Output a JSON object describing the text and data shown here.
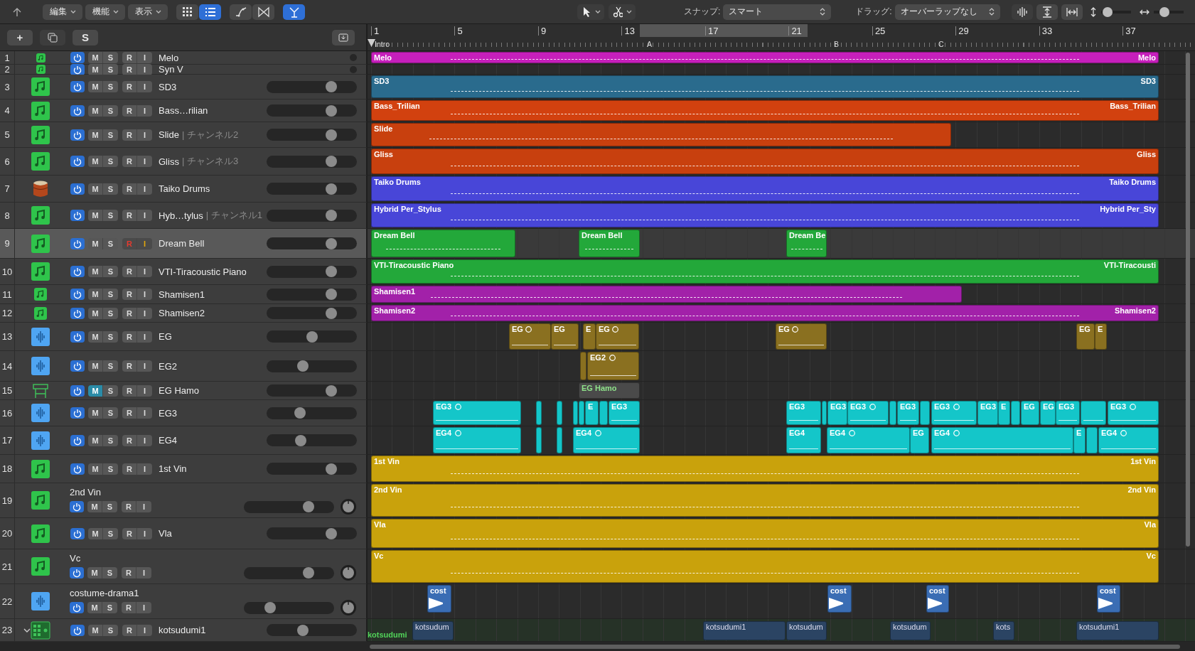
{
  "toolbar": {
    "menus": [
      {
        "label": "編集"
      },
      {
        "label": "機能"
      },
      {
        "label": "表示"
      }
    ],
    "view_tools": [
      {
        "kind": "grid",
        "selected": false
      },
      {
        "kind": "list",
        "selected": true
      },
      {
        "kind": "curve",
        "selected": false
      },
      {
        "kind": "bowtie",
        "selected": false
      },
      {
        "kind": "flex",
        "selected": true
      }
    ],
    "edit_tools": [
      {
        "kind": "pointer"
      },
      {
        "kind": "scissors"
      }
    ],
    "snap": {
      "label": "スナップ:",
      "value": "スマート"
    },
    "drag": {
      "label": "ドラッグ:",
      "value": "オーバーラップなし"
    },
    "zoom_tools": [
      {
        "kind": "waveform"
      },
      {
        "kind": "fit-vertical"
      },
      {
        "kind": "fit-horizontal"
      }
    ],
    "zoom_sliders": [
      {
        "kind": "vertical",
        "level": 0.08
      },
      {
        "kind": "horizontal",
        "level": 0.3
      }
    ]
  },
  "header_tools": [
    {
      "kind": "text",
      "label": "+"
    },
    {
      "kind": "duplicate"
    },
    {
      "kind": "text",
      "label": "S"
    },
    {
      "kind": "catch"
    }
  ],
  "ruler": {
    "bars": [
      "1",
      "5",
      "9",
      "13",
      "17",
      "21",
      "25",
      "29",
      "33",
      "37"
    ],
    "cycle_on": true,
    "markers": [
      {
        "label": "Intro"
      },
      {
        "label": "A"
      },
      {
        "label": "B"
      },
      {
        "label": "C"
      }
    ]
  },
  "tracks": [
    {
      "number": "1",
      "name": "Melo",
      "kind": "instrument",
      "on": true,
      "mute": {
        "label": "M",
        "on": false
      },
      "solo": {
        "label": "S",
        "on": false
      },
      "record": {
        "label": "R",
        "on": false
      },
      "input": {
        "label": "I",
        "on": false
      },
      "selected": false,
      "color": "#c61fbb",
      "regions": [
        {
          "label": "Melo",
          "end_label": "Melo"
        }
      ]
    },
    {
      "number": "2",
      "name": "Syn V",
      "kind": "instrument",
      "on": true,
      "mute": {
        "label": "M",
        "on": false
      },
      "solo": {
        "label": "S",
        "on": false
      },
      "record": {
        "label": "R",
        "on": false
      },
      "input": {
        "label": "I",
        "on": false
      },
      "selected": false
    },
    {
      "number": "3",
      "name": "SD3",
      "kind": "instrument",
      "volume": {
        "level": 0.75
      },
      "on": true,
      "mute": {
        "label": "M",
        "on": false
      },
      "solo": {
        "label": "S",
        "on": false
      },
      "record": {
        "label": "R",
        "on": false
      },
      "input": {
        "label": "I",
        "on": false
      },
      "selected": false,
      "color": "#2a6b8d",
      "regions": [
        {
          "label": "SD3",
          "end_label": "SD3"
        }
      ]
    },
    {
      "number": "4",
      "name": "Bass…rilian",
      "kind": "instrument",
      "volume": {
        "level": 0.75
      },
      "on": true,
      "mute": {
        "label": "M",
        "on": false
      },
      "solo": {
        "label": "S",
        "on": false
      },
      "record": {
        "label": "R",
        "on": false
      },
      "input": {
        "label": "I",
        "on": false
      },
      "selected": false,
      "color": "#d2410f",
      "regions": [
        {
          "label": "Bass_Trilian",
          "end_label": "Bass_Trilian"
        }
      ]
    },
    {
      "number": "5",
      "name": "Slide",
      "channel": "| チャンネル2",
      "kind": "instrument",
      "volume": {
        "level": 0.75
      },
      "on": true,
      "mute": {
        "label": "M",
        "on": false
      },
      "solo": {
        "label": "S",
        "on": false
      },
      "record": {
        "label": "R",
        "on": false
      },
      "input": {
        "label": "I",
        "on": false
      },
      "selected": false,
      "color": "#c8400e",
      "regions": [
        {
          "label": "Slide"
        }
      ]
    },
    {
      "number": "6",
      "name": "Gliss",
      "channel": "| チャンネル3",
      "kind": "instrument",
      "volume": {
        "level": 0.75
      },
      "on": true,
      "mute": {
        "label": "M",
        "on": false
      },
      "solo": {
        "label": "S",
        "on": false
      },
      "record": {
        "label": "R",
        "on": false
      },
      "input": {
        "label": "I",
        "on": false
      },
      "selected": false,
      "color": "#c8400e",
      "regions": [
        {
          "label": "Gliss",
          "end_label": "Gliss"
        }
      ]
    },
    {
      "number": "7",
      "name": "Taiko Drums",
      "kind": "drum",
      "volume": {
        "level": 0.75
      },
      "on": true,
      "mute": {
        "label": "M",
        "on": false
      },
      "solo": {
        "label": "S",
        "on": false
      },
      "record": {
        "label": "R",
        "on": false
      },
      "input": {
        "label": "I",
        "on": false
      },
      "selected": false,
      "color": "#4846d8",
      "regions": [
        {
          "label": "Taiko Drums",
          "end_label": "Taiko Drums"
        }
      ]
    },
    {
      "number": "8",
      "name": "Hyb…tylus",
      "channel": "| チャンネル1",
      "kind": "instrument",
      "volume": {
        "level": 0.75
      },
      "on": true,
      "mute": {
        "label": "M",
        "on": false
      },
      "solo": {
        "label": "S",
        "on": false
      },
      "record": {
        "label": "R",
        "on": false
      },
      "input": {
        "label": "I",
        "on": false
      },
      "selected": false,
      "color": "#4846d8",
      "regions": [
        {
          "label": "Hybrid Per_Stylus",
          "end_label": "Hybrid Per_Sty"
        }
      ]
    },
    {
      "number": "9",
      "name": "Dream Bell",
      "kind": "instrument",
      "volume": {
        "level": 0.75
      },
      "on": true,
      "mute": {
        "label": "M",
        "on": false
      },
      "solo": {
        "label": "S",
        "on": false
      },
      "record": {
        "label": "R",
        "on": true
      },
      "input": {
        "label": "I",
        "on": true
      },
      "selected": true,
      "color": "#23a83a",
      "regions": [
        {
          "label": "Dream Bell"
        },
        {
          "label": "Dream Bell"
        },
        {
          "label": "Dream Be"
        }
      ]
    },
    {
      "number": "10",
      "name": "VTI-Tiracoustic Piano",
      "kind": "instrument",
      "volume": {
        "level": 0.75
      },
      "on": true,
      "mute": {
        "label": "M",
        "on": false
      },
      "solo": {
        "label": "S",
        "on": false
      },
      "record": {
        "label": "R",
        "on": false
      },
      "input": {
        "label": "I",
        "on": false
      },
      "selected": false,
      "color": "#23a83a",
      "regions": [
        {
          "label": "VTI-Tiracoustic Piano",
          "end_label": "VTI-Tiracousti"
        }
      ]
    },
    {
      "number": "11",
      "name": "Shamisen1",
      "kind": "instrument",
      "volume": {
        "level": 0.75
      },
      "on": true,
      "mute": {
        "label": "M",
        "on": false
      },
      "solo": {
        "label": "S",
        "on": false
      },
      "record": {
        "label": "R",
        "on": false
      },
      "input": {
        "label": "I",
        "on": false
      },
      "selected": false,
      "color": "#a221a9",
      "regions": [
        {
          "label": "Shamisen1"
        }
      ]
    },
    {
      "number": "12",
      "name": "Shamisen2",
      "kind": "instrument",
      "volume": {
        "level": 0.75
      },
      "on": true,
      "mute": {
        "label": "M",
        "on": false
      },
      "solo": {
        "label": "S",
        "on": false
      },
      "record": {
        "label": "R",
        "on": false
      },
      "input": {
        "label": "I",
        "on": false
      },
      "selected": false,
      "color": "#a221a9",
      "regions": [
        {
          "label": "Shamisen2",
          "end_label": "Shamisen2"
        }
      ]
    },
    {
      "number": "13",
      "name": "EG",
      "kind": "audio",
      "volume": {
        "level": 0.5
      },
      "on": true,
      "mute": {
        "label": "M",
        "on": false
      },
      "solo": {
        "label": "S",
        "on": false
      },
      "record": {
        "label": "R",
        "on": false
      },
      "input": {
        "label": "I",
        "on": false
      },
      "selected": false,
      "color": "#8a7020",
      "regions": [
        {
          "label": "EG",
          "take_marker": true
        },
        {
          "label": "EG",
          "take_marker": false
        },
        {
          "label": "E",
          "take_marker": false
        },
        {
          "label": "EG",
          "take_marker": true
        },
        {
          "label": "EG",
          "take_marker": true
        },
        {
          "label": "EG",
          "take_marker": false
        },
        {
          "label": "E",
          "take_marker": false
        }
      ]
    },
    {
      "number": "14",
      "name": "EG2",
      "kind": "audio",
      "volume": {
        "level": 0.39
      },
      "on": true,
      "mute": {
        "label": "M",
        "on": false
      },
      "solo": {
        "label": "S",
        "on": false
      },
      "record": {
        "label": "R",
        "on": false
      },
      "input": {
        "label": "I",
        "on": false
      },
      "selected": false,
      "color": "#8a7020",
      "regions": [
        {
          "take_marker": false
        },
        {
          "label": "EG2",
          "take_marker": true
        }
      ]
    },
    {
      "number": "15",
      "name": "EG Hamo",
      "kind": "keyboard",
      "volume": {
        "level": 0.75
      },
      "on": true,
      "mute": {
        "label": "M",
        "on": true
      },
      "solo": {
        "label": "S",
        "on": false
      },
      "record": {
        "label": "R",
        "on": false
      },
      "input": {
        "label": "I",
        "on": false
      },
      "selected": false,
      "color": "#4a4a4a",
      "regions": [
        {
          "label": "EG Hamo"
        }
      ]
    },
    {
      "number": "16",
      "name": "EG3",
      "kind": "audio",
      "volume": {
        "level": 0.35
      },
      "on": true,
      "mute": {
        "label": "M",
        "on": false
      },
      "solo": {
        "label": "S",
        "on": false
      },
      "record": {
        "label": "R",
        "on": false
      },
      "input": {
        "label": "I",
        "on": false
      },
      "selected": false,
      "color": "#14c6c9",
      "regions": [
        {
          "label": "EG3",
          "take_marker": true
        },
        {
          "take_marker": false
        },
        {
          "take_marker": false
        },
        {
          "take_marker": false
        },
        {
          "take_marker": false
        },
        {
          "label": "E",
          "take_marker": false
        },
        {
          "take_marker": false
        },
        {
          "label": "EG3",
          "take_marker": false
        },
        {
          "label": "EG3",
          "take_marker": false
        },
        {
          "take_marker": false
        },
        {
          "label": "EG3",
          "take_marker": false
        },
        {
          "label": "EG3",
          "take_marker": true
        },
        {
          "take_marker": false
        },
        {
          "label": "EG3",
          "take_marker": false
        },
        {
          "take_marker": false
        },
        {
          "label": "EG3",
          "take_marker": true
        },
        {
          "label": "EG3",
          "take_marker": false
        },
        {
          "label": "E",
          "take_marker": false
        },
        {
          "take_marker": false
        },
        {
          "label": "EG",
          "take_marker": false
        },
        {
          "label": "EG",
          "take_marker": false
        },
        {
          "label": "EG3",
          "take_marker": false
        },
        {
          "take_marker": false
        },
        {
          "label": "EG3",
          "take_marker": true
        }
      ]
    },
    {
      "number": "17",
      "name": "EG4",
      "kind": "audio",
      "volume": {
        "level": 0.36
      },
      "on": true,
      "mute": {
        "label": "M",
        "on": false
      },
      "solo": {
        "label": "S",
        "on": false
      },
      "record": {
        "label": "R",
        "on": false
      },
      "input": {
        "label": "I",
        "on": false
      },
      "selected": false,
      "color": "#14c6c9",
      "regions": [
        {
          "label": "EG4",
          "take_marker": true
        },
        {
          "take_marker": false
        },
        {
          "take_marker": false
        },
        {
          "label": "EG4",
          "take_marker": true
        },
        {
          "label": "EG4",
          "take_marker": false
        },
        {
          "label": "EG4",
          "take_marker": true
        },
        {
          "label": "EG",
          "take_marker": false
        },
        {
          "label": "EG4",
          "take_marker": true
        },
        {
          "label": "E",
          "take_marker": false
        },
        {
          "take_marker": false
        },
        {
          "label": "EG4",
          "take_marker": true
        }
      ]
    },
    {
      "number": "18",
      "name": "1st Vin",
      "kind": "instrument",
      "volume": {
        "level": 0.75
      },
      "on": true,
      "mute": {
        "label": "M",
        "on": false
      },
      "solo": {
        "label": "S",
        "on": false
      },
      "record": {
        "label": "R",
        "on": false
      },
      "input": {
        "label": "I",
        "on": false
      },
      "selected": false,
      "color": "#c9a20c",
      "regions": [
        {
          "label": "1st Vin",
          "end_label": "1st Vin"
        }
      ]
    },
    {
      "number": "19",
      "name": "2nd Vin",
      "kind": "instrument",
      "volume": {
        "level": 0.75
      },
      "on": true,
      "mute": {
        "label": "M",
        "on": false
      },
      "solo": {
        "label": "S",
        "on": false
      },
      "record": {
        "label": "R",
        "on": false
      },
      "input": {
        "label": "I",
        "on": false
      },
      "selected": false,
      "color": "#c9a20c",
      "regions": [
        {
          "label": "2nd Vin",
          "end_label": "2nd Vin"
        }
      ]
    },
    {
      "number": "20",
      "name": "Vla",
      "kind": "instrument",
      "volume": {
        "level": 0.75
      },
      "on": true,
      "mute": {
        "label": "M",
        "on": false
      },
      "solo": {
        "label": "S",
        "on": false
      },
      "record": {
        "label": "R",
        "on": false
      },
      "input": {
        "label": "I",
        "on": false
      },
      "selected": false,
      "color": "#c9a20c",
      "regions": [
        {
          "label": "Vla",
          "end_label": "Vla"
        }
      ]
    },
    {
      "number": "21",
      "name": "Vc",
      "kind": "instrument",
      "volume": {
        "level": 0.75
      },
      "on": true,
      "mute": {
        "label": "M",
        "on": false
      },
      "solo": {
        "label": "S",
        "on": false
      },
      "record": {
        "label": "R",
        "on": false
      },
      "input": {
        "label": "I",
        "on": false
      },
      "selected": false,
      "color": "#c9a20c",
      "regions": [
        {
          "label": "Vc",
          "end_label": "Vc"
        }
      ]
    },
    {
      "number": "22",
      "name": "costume-drama1",
      "kind": "audio",
      "volume": {
        "level": 0.26
      },
      "on": true,
      "mute": {
        "label": "M",
        "on": false
      },
      "solo": {
        "label": "S",
        "on": false
      },
      "record": {
        "label": "R",
        "on": false
      },
      "input": {
        "label": "I",
        "on": false
      },
      "selected": false,
      "color": "#3a6db4",
      "regions": [
        {
          "label": "cost"
        },
        {
          "label": "cost"
        },
        {
          "label": "cost"
        },
        {
          "label": "cost"
        }
      ]
    },
    {
      "number": "23",
      "name": "kotsudumi1",
      "kind": "drummer",
      "expanded": true,
      "lane_label": "kotsudumi",
      "volume": {
        "level": 0.39
      },
      "on": true,
      "mute": {
        "label": "M",
        "on": false
      },
      "solo": {
        "label": "S",
        "on": false
      },
      "record": {
        "label": "R",
        "on": false
      },
      "input": {
        "label": "I",
        "on": false
      },
      "selected": false,
      "color": "#2b4463",
      "regions": [
        {
          "label": "kotsudum"
        },
        {
          "label": "kotsudumi1"
        },
        {
          "label": "kotsudum"
        },
        {
          "label": "kotsudum"
        },
        {
          "label": "kots"
        },
        {
          "label": "kotsudumi1"
        }
      ]
    }
  ]
}
